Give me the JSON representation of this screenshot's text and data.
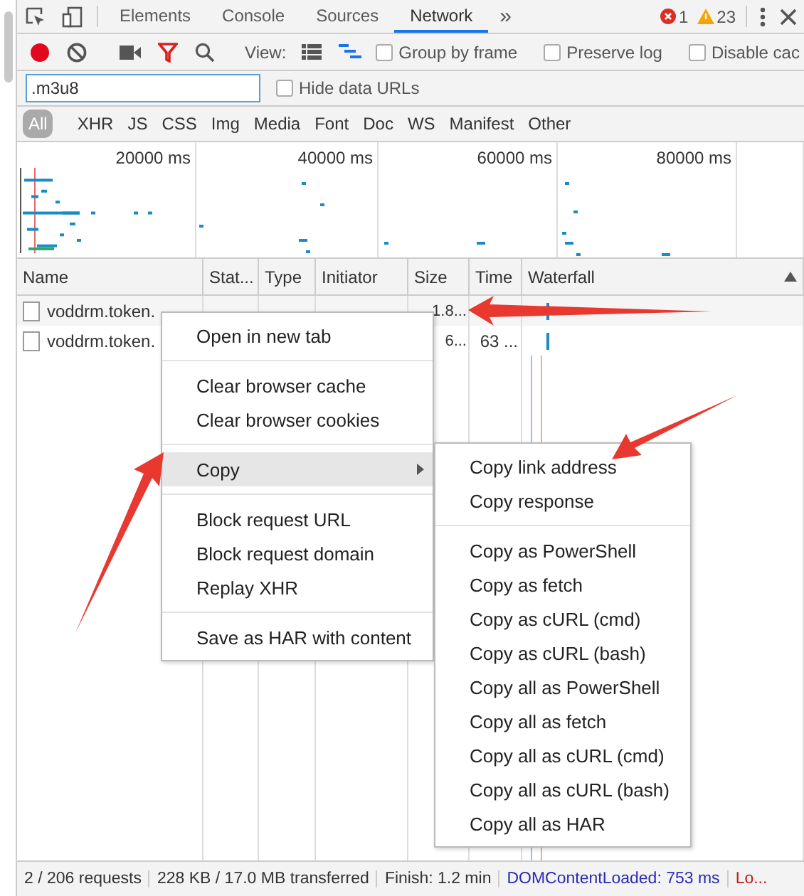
{
  "main_tabs": {
    "items": [
      {
        "label": "Elements",
        "selected": false
      },
      {
        "label": "Console",
        "selected": false
      },
      {
        "label": "Sources",
        "selected": false
      },
      {
        "label": "Network",
        "selected": true
      }
    ],
    "more": "»",
    "errors": "1",
    "warnings": "23"
  },
  "toolbar": {
    "recording": true,
    "view_label": "View:",
    "large_rows": false,
    "show_overview": true,
    "checkboxes": [
      {
        "label": "Group by frame",
        "checked": false
      },
      {
        "label": "Preserve log",
        "checked": false
      },
      {
        "label": "Disable cac",
        "checked": false
      }
    ]
  },
  "filter": {
    "value": ".m3u8",
    "hide_data_urls": {
      "label": "Hide data URLs",
      "checked": false
    }
  },
  "type_filters": [
    {
      "label": "All",
      "selected": true
    },
    {
      "label": "XHR",
      "selected": false
    },
    {
      "label": "JS",
      "selected": false
    },
    {
      "label": "CSS",
      "selected": false
    },
    {
      "label": "Img",
      "selected": false
    },
    {
      "label": "Media",
      "selected": false
    },
    {
      "label": "Font",
      "selected": false
    },
    {
      "label": "Doc",
      "selected": false
    },
    {
      "label": "WS",
      "selected": false
    },
    {
      "label": "Manifest",
      "selected": false
    },
    {
      "label": "Other",
      "selected": false
    }
  ],
  "overview": {
    "ticks": [
      "20000 ms",
      "40000 ms",
      "60000 ms",
      "80000 ms"
    ]
  },
  "table": {
    "columns": [
      "Name",
      "Stat...",
      "Type",
      "Initiator",
      "Size",
      "Time",
      "Waterfall"
    ],
    "sorted_ascending": true,
    "rows": [
      {
        "name": "voddrm.token.",
        "size": "1.8...",
        "time": "",
        "selected": false
      },
      {
        "name": "voddrm.token.",
        "size": "6...",
        "time": "63 ...",
        "selected": false
      }
    ]
  },
  "context_menu": {
    "items": [
      {
        "kind": "item",
        "label": "Open in new tab",
        "selected": false
      },
      {
        "kind": "separator"
      },
      {
        "kind": "item",
        "label": "Clear browser cache",
        "selected": false
      },
      {
        "kind": "item",
        "label": "Clear browser cookies",
        "selected": false
      },
      {
        "kind": "separator"
      },
      {
        "kind": "submenu",
        "label": "Copy",
        "selected": true
      },
      {
        "kind": "separator"
      },
      {
        "kind": "item",
        "label": "Block request URL",
        "selected": false
      },
      {
        "kind": "item",
        "label": "Block request domain",
        "selected": false
      },
      {
        "kind": "item",
        "label": "Replay XHR",
        "selected": false
      },
      {
        "kind": "separator"
      },
      {
        "kind": "item",
        "label": "Save as HAR with content",
        "selected": false
      }
    ],
    "submenu": [
      {
        "kind": "item",
        "label": "Copy link address",
        "selected": false
      },
      {
        "kind": "item",
        "label": "Copy response",
        "selected": false
      },
      {
        "kind": "separator"
      },
      {
        "kind": "item",
        "label": "Copy as PowerShell",
        "selected": false
      },
      {
        "kind": "item",
        "label": "Copy as fetch",
        "selected": false
      },
      {
        "kind": "item",
        "label": "Copy as cURL (cmd)",
        "selected": false
      },
      {
        "kind": "item",
        "label": "Copy as cURL (bash)",
        "selected": false
      },
      {
        "kind": "item",
        "label": "Copy all as PowerShell",
        "selected": false
      },
      {
        "kind": "item",
        "label": "Copy all as fetch",
        "selected": false
      },
      {
        "kind": "item",
        "label": "Copy all as cURL (cmd)",
        "selected": false
      },
      {
        "kind": "item",
        "label": "Copy all as cURL (bash)",
        "selected": false
      },
      {
        "kind": "item",
        "label": "Copy all as HAR",
        "selected": false
      }
    ]
  },
  "status_bar": [
    {
      "kind": "plain",
      "text": "2 / 206 requests"
    },
    {
      "kind": "plain",
      "text": "228 KB / 17.0 MB transferred"
    },
    {
      "kind": "plain",
      "text": "Finish: 1.2 min"
    },
    {
      "kind": "dom",
      "text": "DOMContentLoaded: 753 ms"
    },
    {
      "kind": "load",
      "text": "Lo..."
    }
  ]
}
